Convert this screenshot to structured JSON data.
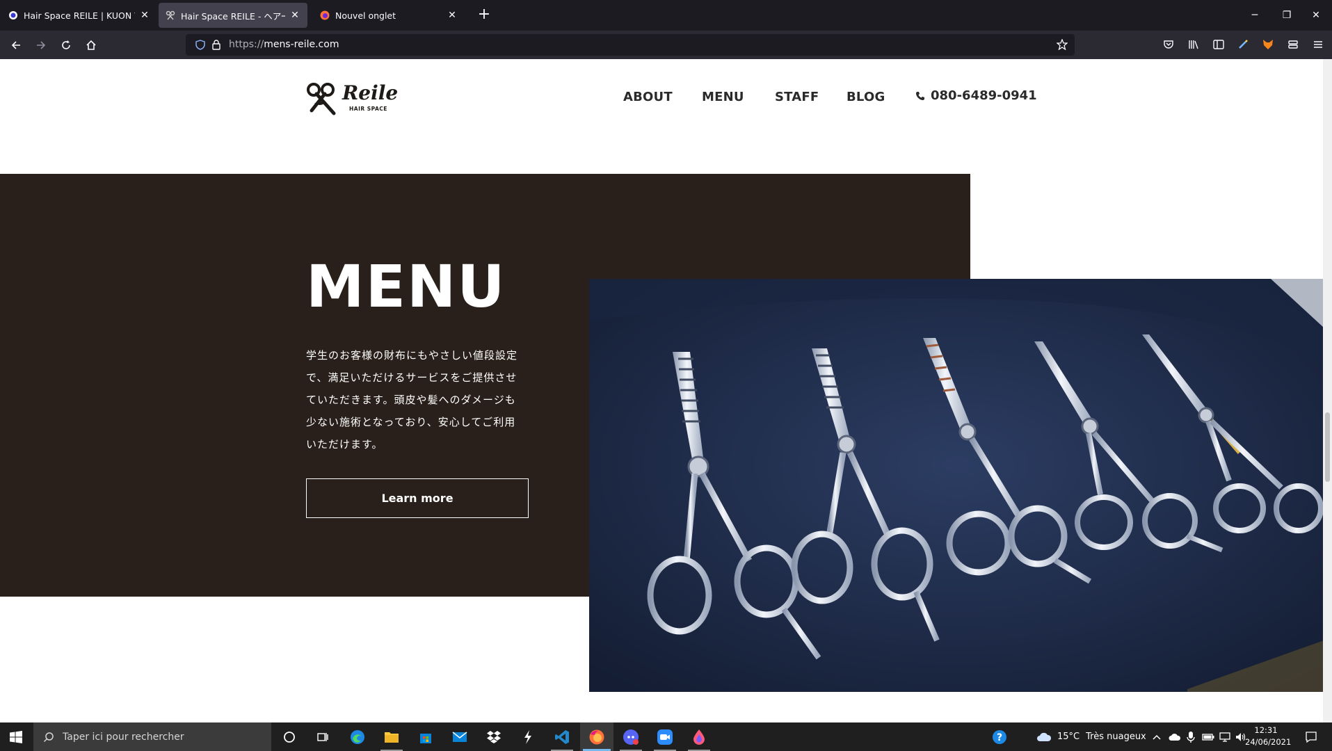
{
  "browser": {
    "tabs": [
      {
        "title": "Hair Space REILE | KUON YAGI P",
        "active": false
      },
      {
        "title": "Hair Space REILE - ヘアースペー",
        "active": true
      },
      {
        "title": "Nouvel onglet",
        "active": false
      }
    ],
    "url_protocol": "https://",
    "url_host": "mens-reile.com"
  },
  "site": {
    "logo_text": "Reile",
    "logo_sub": "HAIR SPACE",
    "nav": [
      "ABOUT",
      "MENU",
      "STAFF",
      "BLOG"
    ],
    "phone": "080-6489-0941"
  },
  "hero": {
    "title": "MENU",
    "description_lines": [
      "学生のお客様の財布にもやさしい値段設定",
      "で、満足いただけるサービスをご提供させ",
      "ていただきます。頭皮や髪へのダメージも",
      "少ない施術となっており、安心してご利用",
      "いただけます。"
    ],
    "button": "Learn more"
  },
  "taskbar": {
    "search_placeholder": "Taper ici pour rechercher",
    "weather_temp": "15°C",
    "weather_desc": "Très nuageux",
    "time": "12:31",
    "date": "24/06/2021"
  },
  "colors": {
    "hero_bg": "#2a201b",
    "photo_bg": "#1f2d4d"
  }
}
